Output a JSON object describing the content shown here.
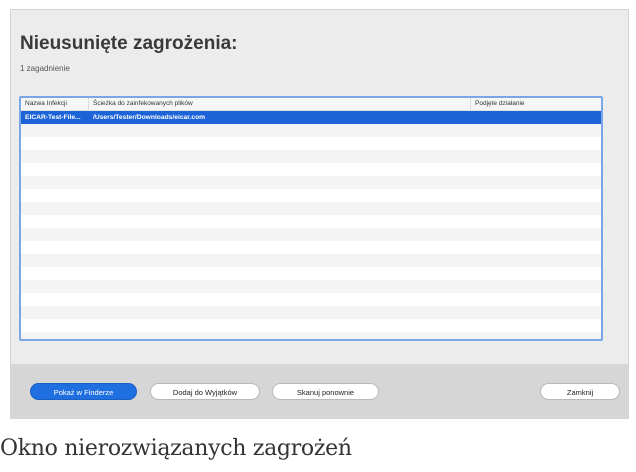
{
  "dialog": {
    "title": "Nieusunięte zagrożenia:",
    "subtitle": "1 zagadnienie"
  },
  "table": {
    "columns": [
      "Nazwa Infekcji",
      "Ścieżka do zainfekowanych plików",
      "Podjęte działanie"
    ],
    "rows": [
      {
        "name": "EICAR-Test-File...",
        "path": "/Users/Tester/Downloads/eicar.com",
        "action": "",
        "selected": true
      }
    ]
  },
  "buttons": {
    "show_in_finder": "Pokaż w Finderze",
    "add_to_exceptions": "Dodaj do Wyjątków",
    "rescan": "Skanuj ponownie",
    "close": "Zamknij"
  },
  "caption": "Okno nierozwiązanych zagrożeń"
}
